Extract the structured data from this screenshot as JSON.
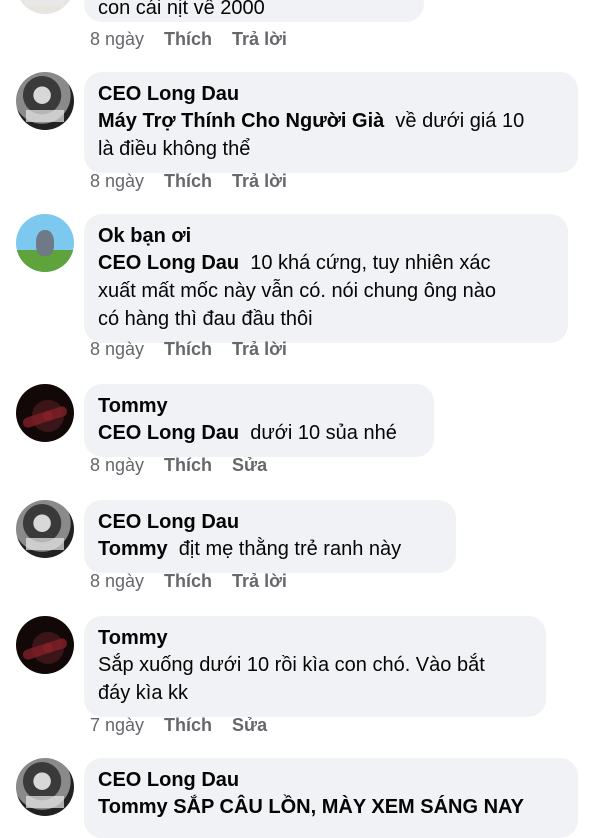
{
  "comments": [
    {
      "text": "con cái nịt về 2000",
      "time": "8 ngày",
      "like": "Thích",
      "action": "Trả lời"
    },
    {
      "author": "CEO Long Dau",
      "mention": "Máy Trợ Thính Cho Người Già",
      "text": "về dưới giá 10",
      "text2": "là điều không thể",
      "time": "8 ngày",
      "like": "Thích",
      "action": "Trả lời"
    },
    {
      "author": "Ok bạn ơi",
      "mention": "CEO Long Dau",
      "text": "10 khá cứng, tuy nhiên xác",
      "text2": "xuất mất mốc này vẫn có. nói chung ông nào",
      "text3": "có hàng thì đau đầu thôi",
      "time": "8 ngày",
      "like": "Thích",
      "action": "Trả lời"
    },
    {
      "author": "Tommy",
      "mention": "CEO Long Dau",
      "text": "dưới 10 sủa nhé",
      "time": "8 ngày",
      "like": "Thích",
      "action": "Sửa"
    },
    {
      "author": "CEO Long Dau",
      "mention": "Tommy",
      "text": "địt mẹ thằng trẻ ranh này",
      "time": "8 ngày",
      "like": "Thích",
      "action": "Trả lời"
    },
    {
      "author": "Tommy",
      "text": "Sắp xuống dưới 10 rồi kìa con chó. Vào bắt",
      "text2": "đáy kìa kk",
      "time": "7 ngày",
      "like": "Thích",
      "action": "Sửa"
    },
    {
      "author": "CEO Long Dau",
      "text": "Tommy SẮP CÂU LỒN, MÀY XEM SÁNG NAY"
    }
  ]
}
